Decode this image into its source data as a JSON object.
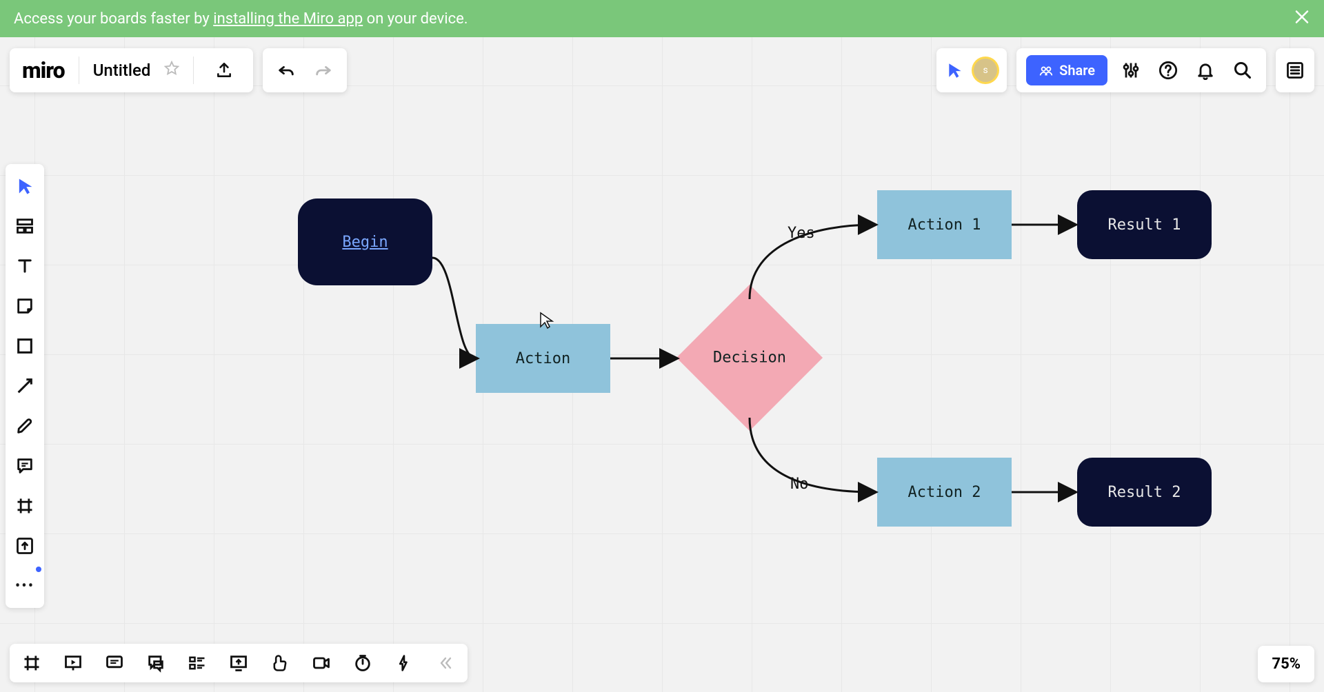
{
  "banner": {
    "text_prefix": "Access your boards faster by ",
    "link_text": "installing the Miro app",
    "text_suffix": " on your device."
  },
  "header": {
    "logo": "miro",
    "title": "Untitled"
  },
  "share": {
    "label": "Share",
    "avatar_initial": "s"
  },
  "zoom": {
    "level": "75%"
  },
  "flow": {
    "begin": "Begin",
    "action": "Action",
    "decision": "Decision",
    "yes": "Yes",
    "no": "No",
    "action1": "Action 1",
    "action2": "Action 2",
    "result1": "Result 1",
    "result2": "Result 2"
  }
}
